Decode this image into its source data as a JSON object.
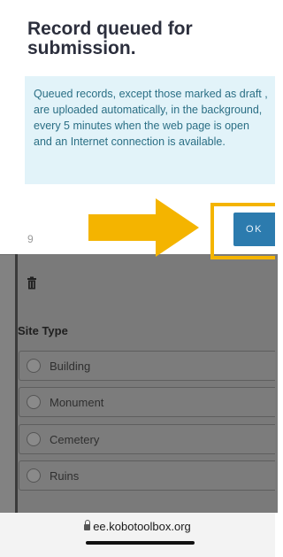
{
  "modal": {
    "title": "Record queued for submission.",
    "message": "Queued records, except those marked as draft , are uploaded automatically, in the background, every 5 minutes when the web page is open and an Internet connection is available.",
    "footer_number": "9",
    "ok_label": "OK"
  },
  "form": {
    "site_type_label": "Site Type",
    "options": [
      "Building",
      "Monument",
      "Cemetery",
      "Ruins"
    ]
  },
  "browser": {
    "url": "ee.kobotoolbox.org"
  },
  "colors": {
    "accent": "#2c7bae",
    "highlight": "#f4b400",
    "notice_bg": "#e2f3f9",
    "notice_text": "#2b6f85"
  },
  "icons": [
    "trash-icon",
    "arrow-right-icon",
    "lock-icon",
    "radio-icon"
  ]
}
